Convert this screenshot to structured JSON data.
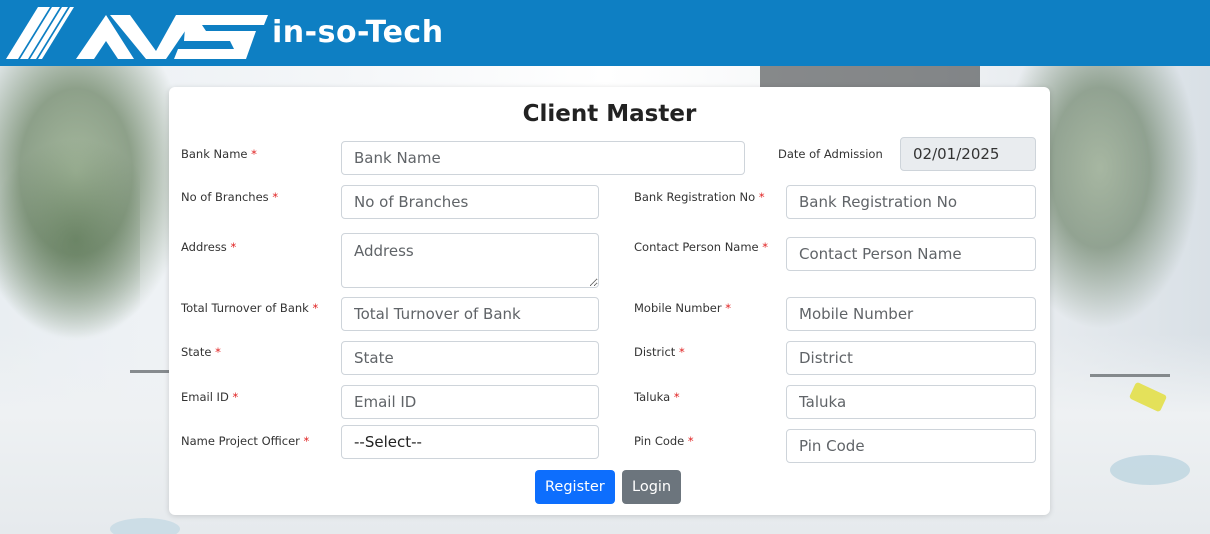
{
  "header": {
    "brand": "in-so-Tech",
    "logo_icon": "ans-logo-icon",
    "bg_color": "#0e7fc3"
  },
  "form": {
    "title": "Client Master",
    "required_mark": "*",
    "fields": {
      "bank_name": {
        "label": "Bank Name",
        "placeholder": "Bank Name"
      },
      "date_of_admission": {
        "label": "Date of Admission",
        "value": "02/01/2025"
      },
      "no_of_branches": {
        "label": "No of Branches",
        "placeholder": "No of Branches"
      },
      "bank_registration_no": {
        "label": "Bank Registration No",
        "placeholder": "Bank Registration No"
      },
      "address": {
        "label": "Address",
        "placeholder": "Address"
      },
      "contact_person_name": {
        "label": "Contact Person Name",
        "placeholder": "Contact Person Name"
      },
      "total_turnover": {
        "label": "Total Turnover of Bank",
        "placeholder": "Total Turnover of Bank"
      },
      "mobile_number": {
        "label": "Mobile Number",
        "placeholder": "Mobile Number"
      },
      "state": {
        "label": "State",
        "placeholder": "State"
      },
      "district": {
        "label": "District",
        "placeholder": "District"
      },
      "email_id": {
        "label": "Email ID",
        "placeholder": "Email ID"
      },
      "taluka": {
        "label": "Taluka",
        "placeholder": "Taluka"
      },
      "project_officer": {
        "label": "Name Project Officer",
        "selected": "--Select--"
      },
      "pin_code": {
        "label": "Pin Code",
        "placeholder": "Pin Code"
      }
    },
    "buttons": {
      "register": "Register",
      "login": "Login"
    }
  },
  "colors": {
    "primary": "#0d6efd",
    "secondary": "#6c757d",
    "required": "#e02020"
  }
}
